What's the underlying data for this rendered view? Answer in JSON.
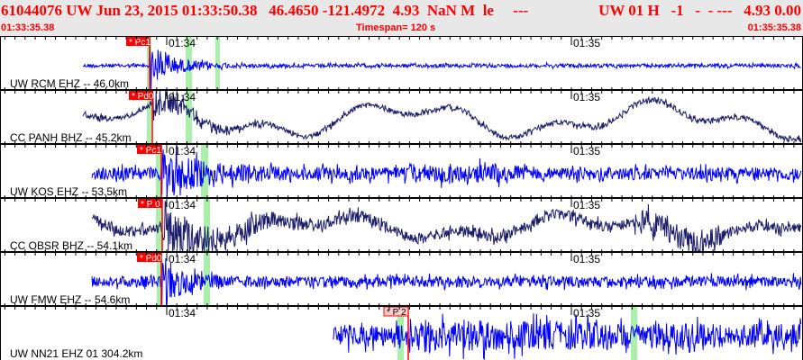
{
  "header": {
    "title": "61044076 UW Jun 23, 2015 01:33:50.38   46.4650 -121.4972  4.93  NaN M  le     ---",
    "title_right": "UW 01 H   -1   -  - ---   4.93 0.00",
    "start_time": "01:33:35.38",
    "timespan": "Timespan= 120 s",
    "end_time": "01:35:35.38"
  },
  "time_labels": [
    "01:34",
    "01:35"
  ],
  "traces": [
    {
      "station": "UW RCM EHZ -- 46.0km",
      "pick": "* Pc1",
      "color": "#0000ff"
    },
    {
      "station": "CC PANH BHZ -- 45.2km",
      "pick": "* Pd0",
      "color": "#1c1c6a"
    },
    {
      "station": "UW KOS EHZ -- 53.5km",
      "pick": "* Pc1",
      "color": "#0000ff"
    },
    {
      "station": "CC OBSR BHZ -- 54.1km",
      "pick": "* P 0",
      "color": "#1c1c6a"
    },
    {
      "station": "UW FMW EHZ -- 54.6km",
      "pick": "* Pd0",
      "color": "#0000ff"
    },
    {
      "station": "UW NN21 EHZ 01 304.2km",
      "pick": "* P 2",
      "color": "#0000ff"
    }
  ],
  "colors": {
    "pick_line": "#ff0000",
    "pick_label": "#ff0000",
    "pick_label_weak": "#ffcccc",
    "window": "#aaf0aa"
  }
}
